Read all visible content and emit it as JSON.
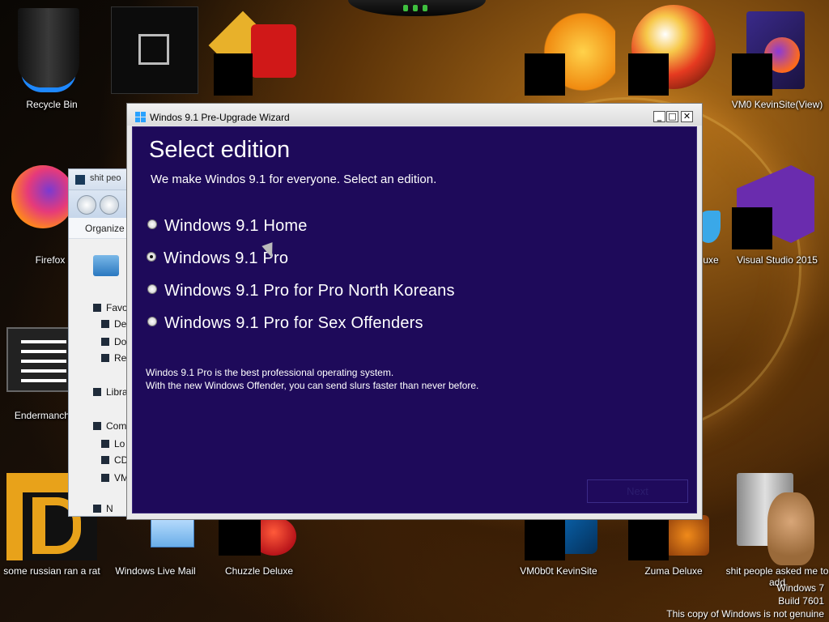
{
  "desktop": {
    "icons": [
      {
        "label": "Recycle Bin"
      },
      {
        "label": "Firefox"
      },
      {
        "label": "Endermanch@"
      },
      {
        "label": "VM0 KevinSite(View)"
      },
      {
        "label": "uxe"
      },
      {
        "label": "Visual Studio 2015"
      },
      {
        "label": "some russian ran a rat"
      },
      {
        "label": "Windows Live Mail"
      },
      {
        "label": "Chuzzle Deluxe"
      },
      {
        "label": "VM0b0t KevinSite"
      },
      {
        "label": "Zuma Deluxe"
      },
      {
        "label": "shit people asked me to add"
      }
    ],
    "genuine_notice": {
      "line1": "Windows 7",
      "line2": "Build 7601",
      "line3": "This copy of Windows is not genuine"
    }
  },
  "explorer": {
    "title": "shit peo",
    "organize": "Organize",
    "sidebar": [
      "Favo",
      "De",
      "Do",
      "Re",
      "Libra",
      "Com",
      "Lo",
      "CD",
      "VM",
      "N"
    ]
  },
  "wizard": {
    "window_title": "Windos 9.1 Pre-Upgrade Wizard",
    "buttons": {
      "minimize": "_",
      "maximize": "□",
      "close": "✕"
    },
    "heading": "Select edition",
    "subheading": "We make Windos 9.1 for everyone. Select an edition.",
    "editions": [
      {
        "label": "Windows 9.1 Home",
        "selected": false
      },
      {
        "label": "Windows 9.1 Pro",
        "selected": true
      },
      {
        "label": "Windows 9.1 Pro for Pro North Koreans",
        "selected": false
      },
      {
        "label": "Windows 9.1 Pro for Sex Offenders",
        "selected": false
      }
    ],
    "description_line1": "Windos 9.1 Pro is the best professional operating system.",
    "description_line2": "With the new Windows Offender, you can send slurs faster than never before.",
    "next_label": "Next"
  }
}
